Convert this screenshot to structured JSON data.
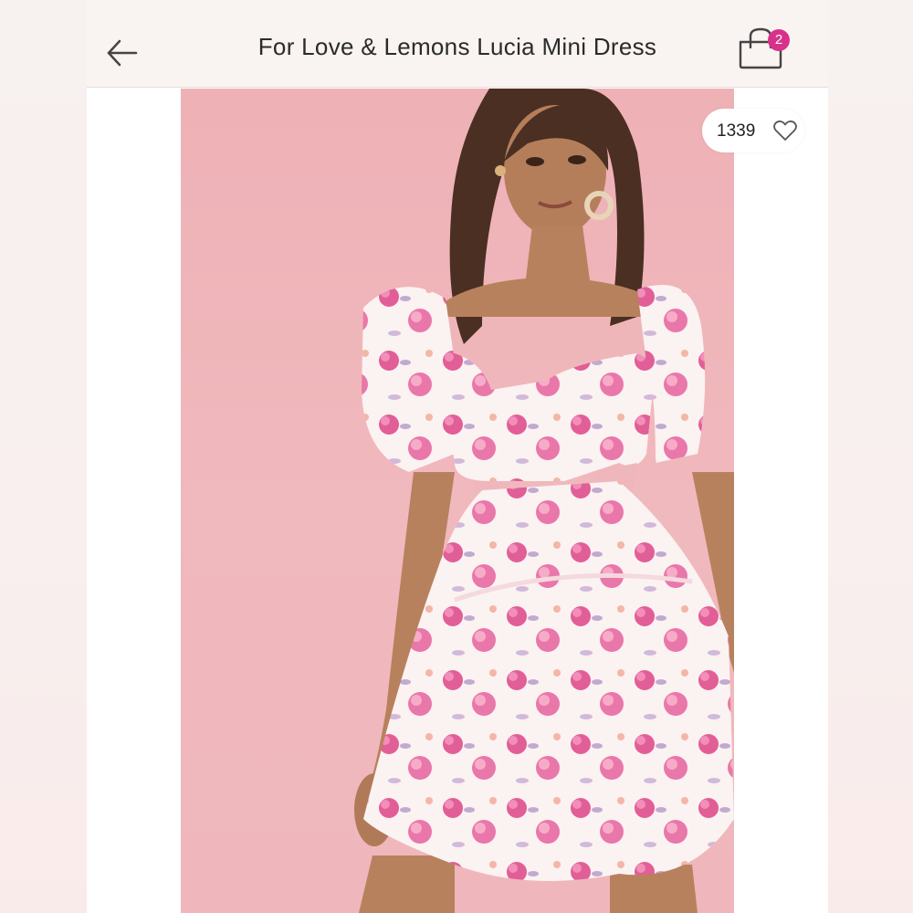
{
  "header": {
    "title": "For Love & Lemons Lucia Mini Dress",
    "bag_count": "2"
  },
  "listing": {
    "likes": "1339"
  },
  "colors": {
    "accent_badge": "#d8318a",
    "photo_background": "#eeb1b6",
    "dress_floral_pink": "#e25e97"
  },
  "icons": {
    "back": "arrow-left-icon",
    "bag": "shopping-bag-icon",
    "like": "heart-outline-icon"
  }
}
